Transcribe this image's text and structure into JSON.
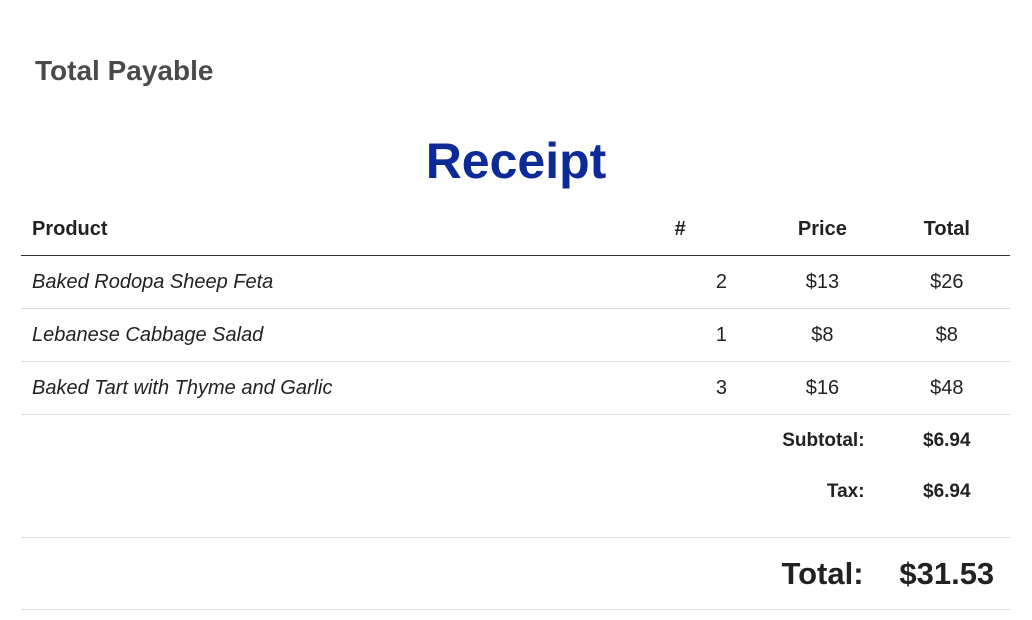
{
  "page": {
    "heading": "Total Payable"
  },
  "receipt": {
    "title": "Receipt",
    "columns": {
      "product": "Product",
      "qty": "#",
      "price": "Price",
      "total": "Total"
    },
    "items": [
      {
        "product": "Baked Rodopa Sheep Feta",
        "qty": "2",
        "price": "$13",
        "total": "$26"
      },
      {
        "product": "Lebanese Cabbage Salad",
        "qty": "1",
        "price": "$8",
        "total": "$8"
      },
      {
        "product": "Baked Tart with Thyme and Garlic",
        "qty": "3",
        "price": "$16",
        "total": "$48"
      }
    ],
    "summary": {
      "subtotal_label": "Subtotal:",
      "subtotal_value": "$6.94",
      "tax_label": "Tax:",
      "tax_value": "$6.94",
      "grand_label": "Total:",
      "grand_value": "$31.53"
    }
  },
  "colors": {
    "title": "#0d2a96",
    "heading": "#4a4a4a",
    "text": "#222222"
  }
}
